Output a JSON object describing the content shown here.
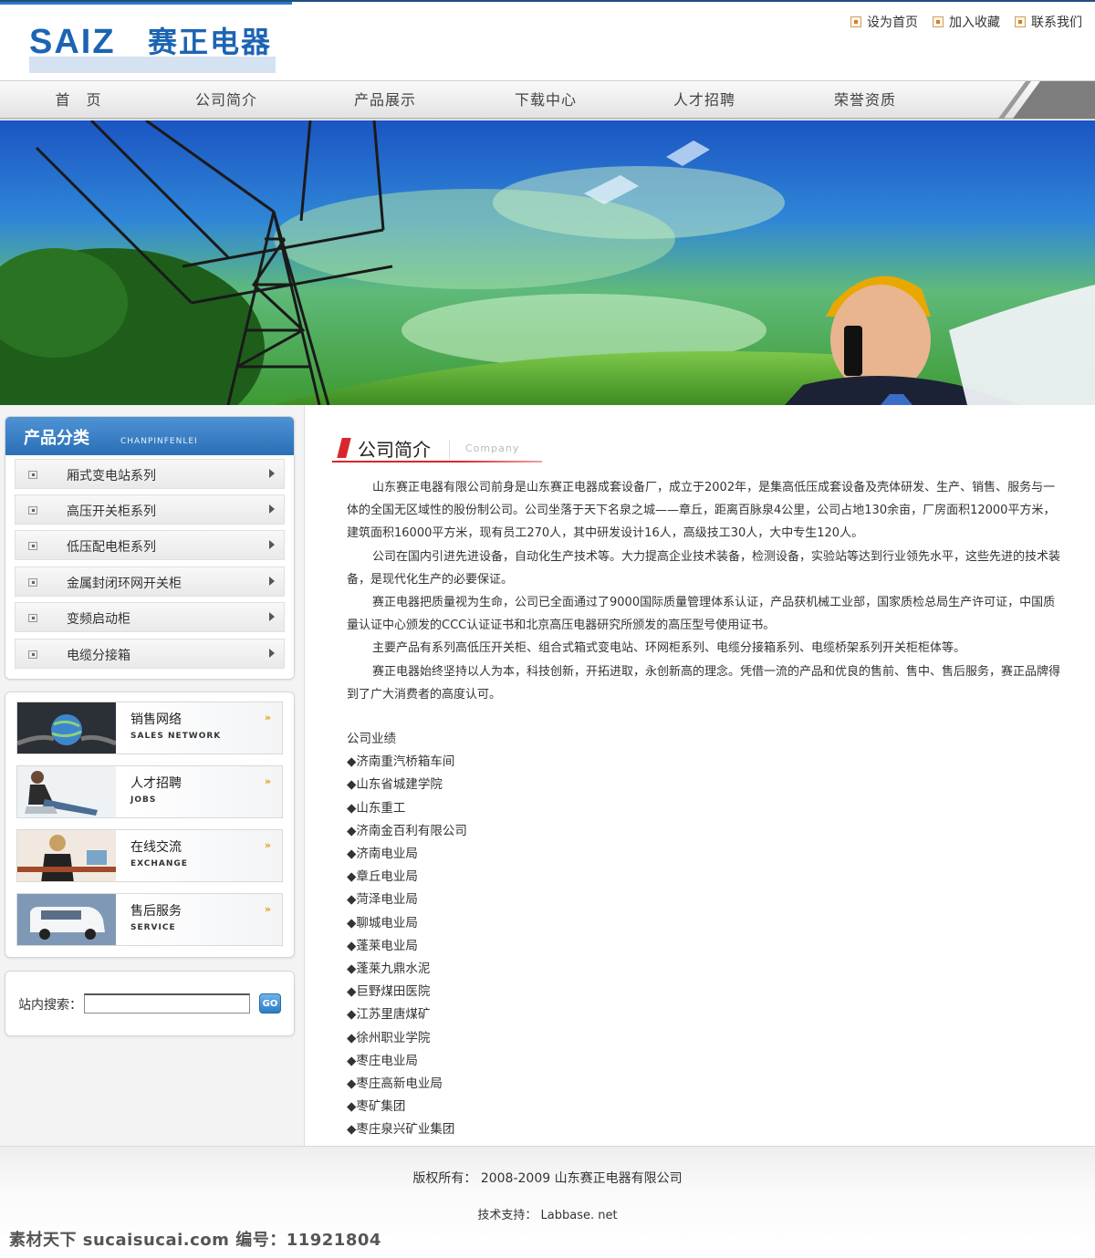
{
  "brand": {
    "logo_text": "SAIZ",
    "logo_cn": "赛正电器"
  },
  "top_links": [
    "设为首页",
    "加入收藏",
    "联系我们"
  ],
  "nav": [
    "首　页",
    "公司简介",
    "产品展示",
    "下载中心",
    "人才招聘",
    "荣誉资质"
  ],
  "categories": {
    "title": "产品分类",
    "subtitle": "CHANPINFENLEI",
    "items": [
      "厢式变电站系列",
      "高压开关柜系列",
      "低压配电柜系列",
      "金属封闭环网开关柜",
      "变频启动柜",
      "电缆分接箱"
    ]
  },
  "services": [
    {
      "title": "销售网络",
      "subtitle": "SALES NETWORK",
      "icon": "globe-icon"
    },
    {
      "title": "人才招聘",
      "subtitle": "JOBS",
      "icon": "person-icon"
    },
    {
      "title": "在线交流",
      "subtitle": "EXCHANGE",
      "icon": "chat-icon"
    },
    {
      "title": "售后服务",
      "subtitle": "SERVICE",
      "icon": "van-icon"
    }
  ],
  "search": {
    "label": "站内搜索：",
    "value": "",
    "button": "GO"
  },
  "section": {
    "title": "公司简介",
    "subtitle": "Company"
  },
  "article": [
    "山东赛正电器有限公司前身是山东赛正电器成套设备厂，成立于2002年，是集高低压成套设备及壳体研发、生产、销售、服务与一体的全国无区域性的股份制公司。公司坐落于天下名泉之城——章丘，距离百脉泉4公里，公司占地130余亩，厂房面积12000平方米，建筑面积16000平方米，现有员工270人，其中研发设计16人，高级技工30人，大中专生120人。",
    "公司在国内引进先进设备，自动化生产技术等。大力提高企业技术装备，检测设备，实验站等达到行业领先水平，这些先进的技术装备，是现代化生产的必要保证。",
    "赛正电器把质量视为生命，公司已全面通过了9000国际质量管理体系认证，产品获机械工业部，国家质检总局生产许可证，中国质量认证中心颁发的CCC认证证书和北京高压电器研究所颁发的高压型号使用证书。",
    "主要产品有系列高低压开关柜、组合式箱式变电站、环网柜系列、电缆分接箱系列、电缆桥架系列开关柜柜体等。",
    "赛正电器始终坚持以人为本，科技创新，开拓进取，永创新高的理念。凭借一流的产品和优良的售前、售中、售后服务，赛正品牌得到了广大消费者的高度认可。"
  ],
  "performance": {
    "heading": "公司业绩",
    "items": [
      "◆济南重汽桥箱车间",
      "◆山东省城建学院",
      "◆山东重工",
      "◆济南金百利有限公司",
      "◆济南电业局",
      "◆章丘电业局",
      "◆菏泽电业局",
      "◆聊城电业局",
      "◆蓬莱电业局",
      "◆蓬莱九鼎水泥",
      "◆巨野煤田医院",
      "◆江苏里唐煤矿",
      "◆徐州职业学院",
      "◆枣庄电业局",
      "◆枣庄高新电业局",
      "◆枣矿集团",
      "◆枣庄泉兴矿业集团"
    ]
  },
  "footer": {
    "copyright": "版权所有：  2008-2009  山东赛正电器有限公司",
    "support": "技术支持：  Labbase. net",
    "watermark": "素材天下 sucaisucai.com  编号：11921804"
  }
}
